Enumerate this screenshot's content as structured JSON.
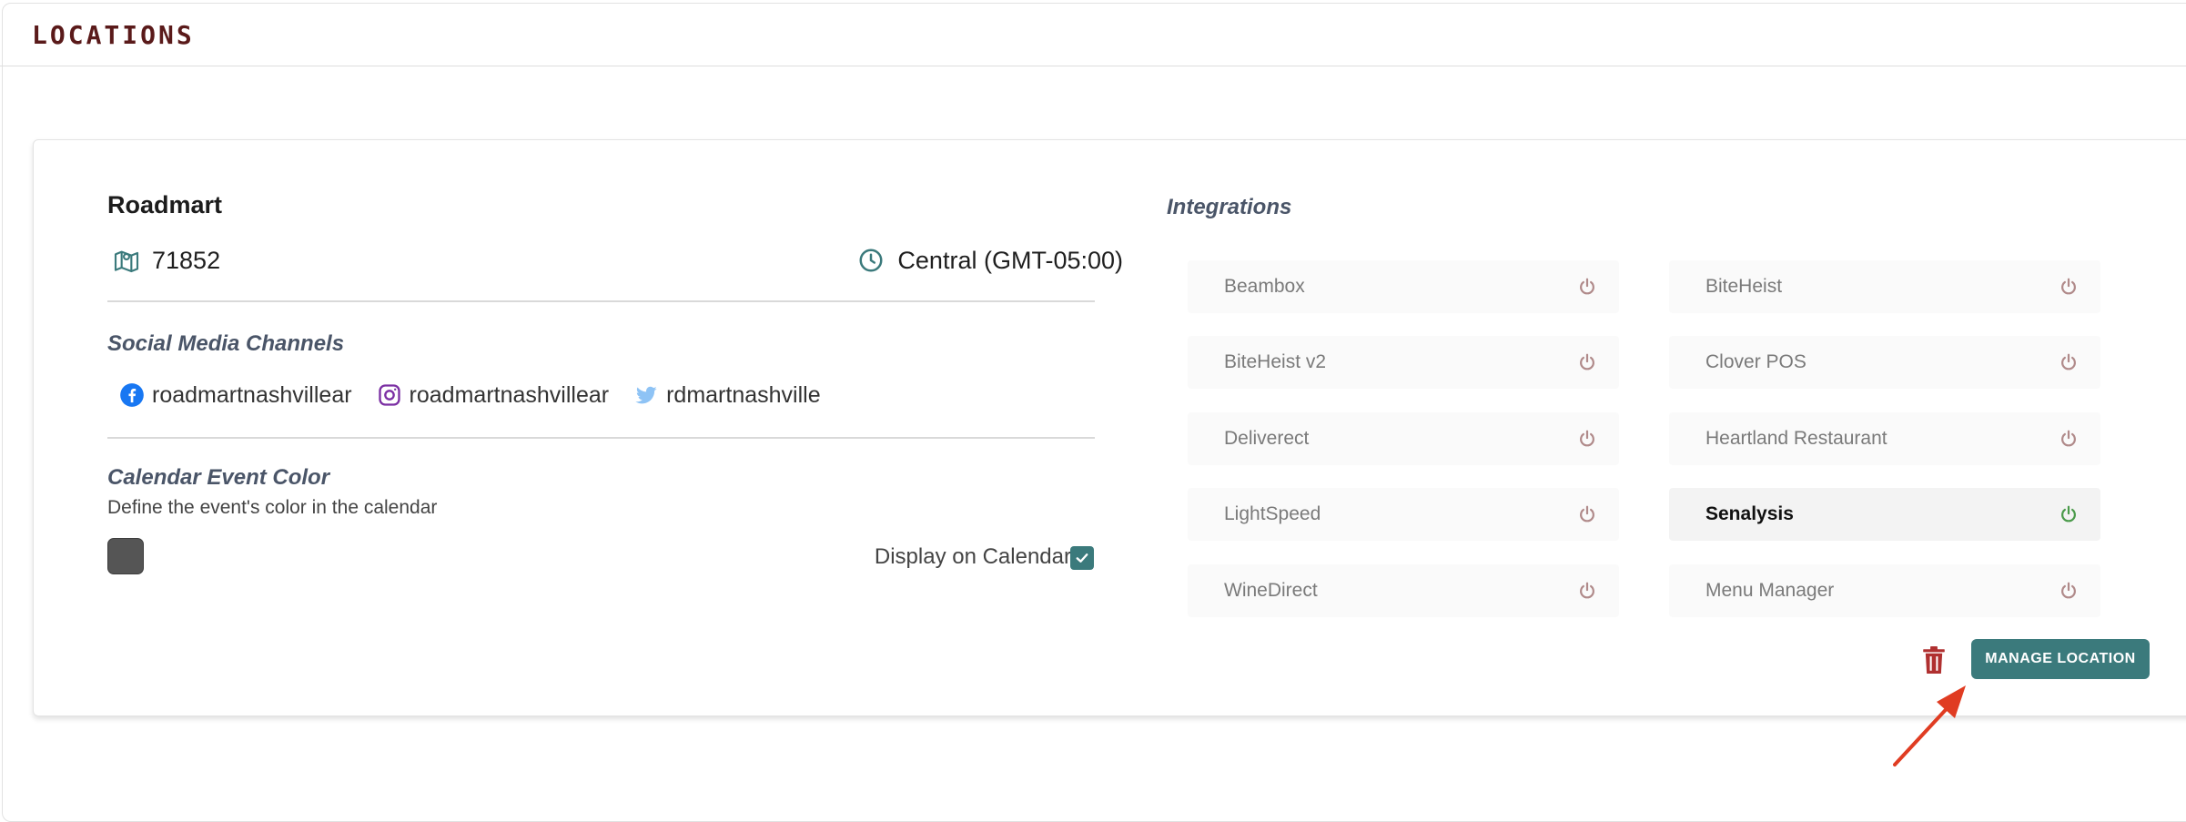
{
  "section": {
    "title": "LOCATIONS"
  },
  "location": {
    "name": "Roadmart",
    "code": "71852",
    "timezone": "Central (GMT-05:00)"
  },
  "social": {
    "title": "Social Media Channels",
    "channels": [
      {
        "icon": "facebook-icon",
        "handle": "roadmartnashvillear"
      },
      {
        "icon": "instagram-icon",
        "handle": "roadmartnashvillear"
      },
      {
        "icon": "twitter-icon",
        "handle": "rdmartnashville"
      }
    ]
  },
  "calendar": {
    "title": "Calendar Event Color",
    "description": "Define the event's color in the calendar",
    "event_color": "#555555",
    "display_label": "Display on Calendar",
    "display_checked": true
  },
  "integrations": {
    "title": "Integrations",
    "items": [
      {
        "name": "Beambox",
        "active": false
      },
      {
        "name": "BiteHeist",
        "active": false
      },
      {
        "name": "BiteHeist v2",
        "active": false
      },
      {
        "name": "Clover POS",
        "active": false
      },
      {
        "name": "Deliverect",
        "active": false
      },
      {
        "name": "Heartland Restaurant",
        "active": false
      },
      {
        "name": "LightSpeed",
        "active": false
      },
      {
        "name": "Senalysis",
        "active": true
      },
      {
        "name": "WineDirect",
        "active": false
      },
      {
        "name": "Menu Manager",
        "active": false
      }
    ]
  },
  "actions": {
    "manage_label": "MANAGE LOCATION"
  },
  "colors": {
    "accent": "#3b7a7c",
    "title": "#5a1a1a",
    "power_off": "#b08a8a",
    "power_on": "#4a9a4a",
    "trash": "#b03030",
    "annotation_arrow": "#e03c22"
  }
}
